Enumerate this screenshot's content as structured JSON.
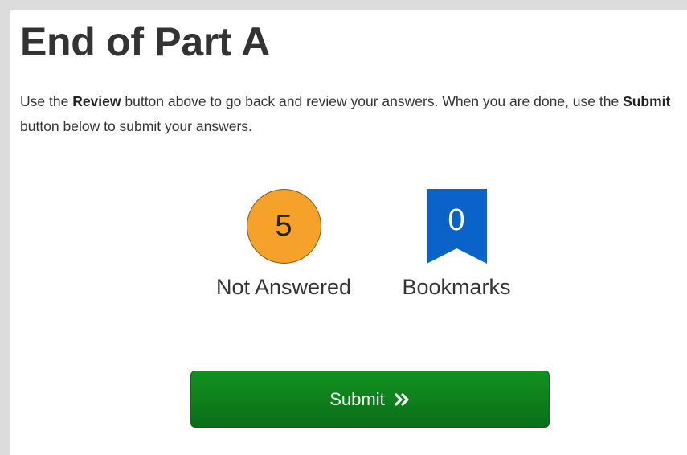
{
  "page": {
    "title": "End of Part A"
  },
  "instructions": {
    "part1": "Use the ",
    "review_word": "Review",
    "part2": " button above to go back and review your answers. When you are done, use the ",
    "submit_word": "Submit",
    "part3": " button below to submit your answers."
  },
  "stats": {
    "not_answered": {
      "count": "5",
      "label": "Not Answered",
      "color": "#f6a12a",
      "icon": "circle-badge"
    },
    "bookmarks": {
      "count": "0",
      "label": "Bookmarks",
      "color": "#0a63c9",
      "icon": "bookmark-icon"
    }
  },
  "submit": {
    "label": "Submit",
    "icon": "double-chevron-right-icon",
    "color": "#0f8a1d"
  }
}
